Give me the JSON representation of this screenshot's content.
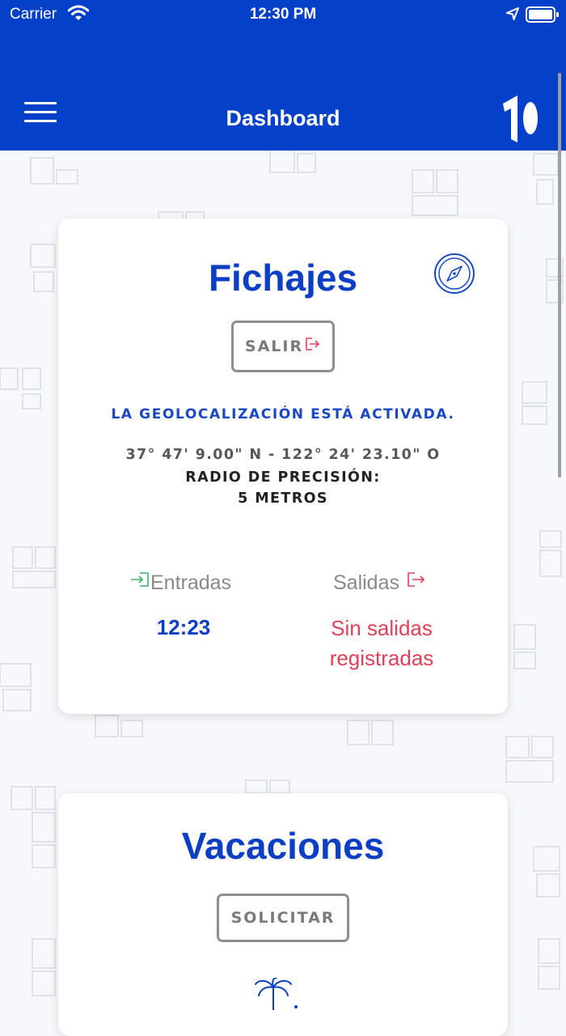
{
  "status_bar": {
    "carrier": "Carrier",
    "time": "12:30 PM"
  },
  "navbar": {
    "title": "Dashboard"
  },
  "fichajes": {
    "title": "Fichajes",
    "exit_button_label": "SALIR",
    "geolocation_status": "LA GEOLOCALIZACIÓN ESTÁ ACTIVADA.",
    "coordinates": "37° 47' 9.00\" N - 122° 24' 23.10\" O",
    "precision_label": "RADIO DE PRECISIÓN:",
    "precision_value": "5 METROS",
    "entradas_label": "Entradas",
    "entradas_value": "12:23",
    "salidas_label": "Salidas",
    "salidas_value_line1": "Sin salidas",
    "salidas_value_line2": "registradas"
  },
  "vacaciones": {
    "title": "Vacaciones",
    "request_button_label": "SOLICITAR"
  },
  "icons": {
    "menu": "hamburger-menu-icon",
    "logo": "app-logo",
    "compass": "compass-icon",
    "exit": "exit-icon",
    "enter": "enter-icon",
    "palm": "palm-tree-icon"
  },
  "colors": {
    "brand_blue": "#0440c8",
    "title_blue": "#0d3fc4",
    "enter_green": "#3cb36b",
    "exit_red": "#e0415a",
    "muted_gray": "#8a8a8a"
  }
}
